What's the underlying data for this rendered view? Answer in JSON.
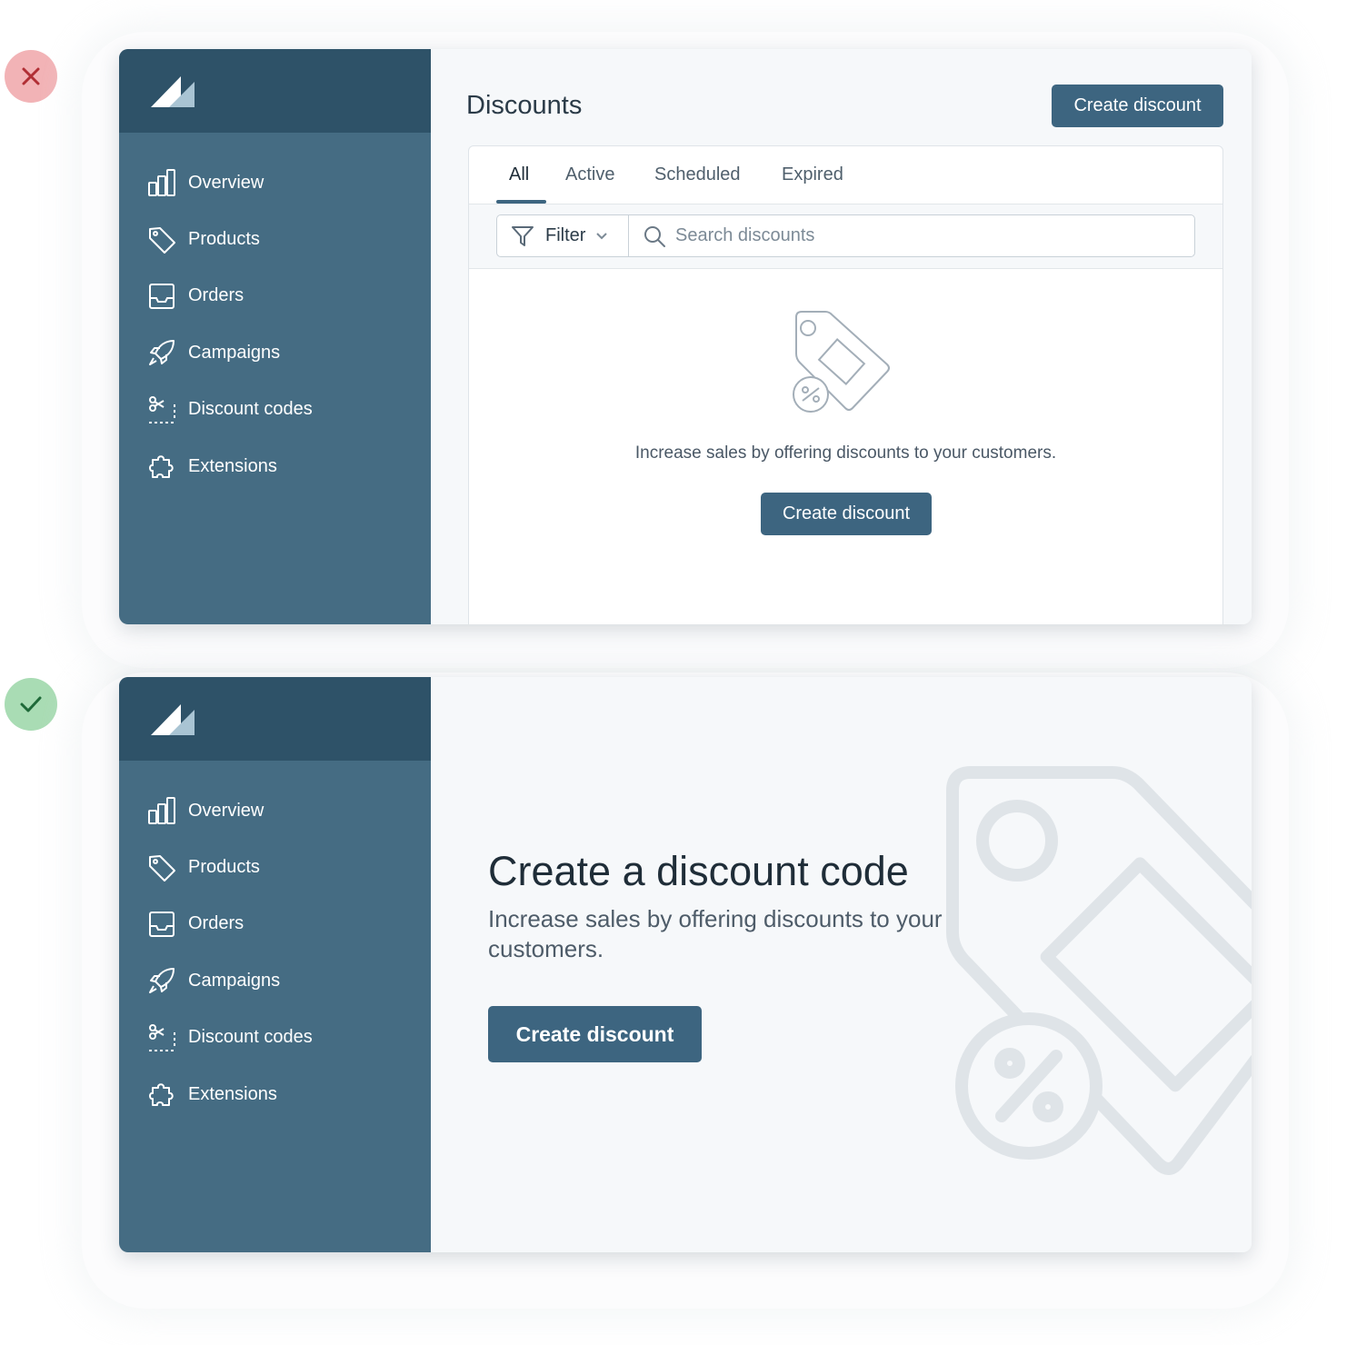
{
  "colors": {
    "sidebar": "#456c83",
    "sidebar_header": "#2e5268",
    "primary_button": "#3d6580",
    "main_background": "#f6f8fa",
    "bad_badge": "#f2b3b6",
    "good_badge": "#a9dcb4"
  },
  "badges": {
    "bad_icon": "close-x-icon",
    "good_icon": "checkmark-icon"
  },
  "sidebar": {
    "items": [
      {
        "label": "Overview",
        "icon": "bar-chart-icon"
      },
      {
        "label": "Products",
        "icon": "tag-icon"
      },
      {
        "label": "Orders",
        "icon": "inbox-icon"
      },
      {
        "label": "Campaigns",
        "icon": "rocket-icon"
      },
      {
        "label": "Discount codes",
        "icon": "scissors-coupon-icon"
      },
      {
        "label": "Extensions",
        "icon": "puzzle-icon"
      }
    ]
  },
  "top": {
    "title": "Discounts",
    "create_label": "Create discount",
    "tabs": [
      "All",
      "Active",
      "Scheduled",
      "Expired"
    ],
    "active_tab": "All",
    "filter_label": "Filter",
    "search_placeholder": "Search discounts",
    "empty_text": "Increase sales by offering discounts to your customers.",
    "empty_button": "Create discount"
  },
  "bottom": {
    "title": "Create a discount code",
    "subtitle": "Increase sales by offering discounts to your customers.",
    "button": "Create discount"
  }
}
